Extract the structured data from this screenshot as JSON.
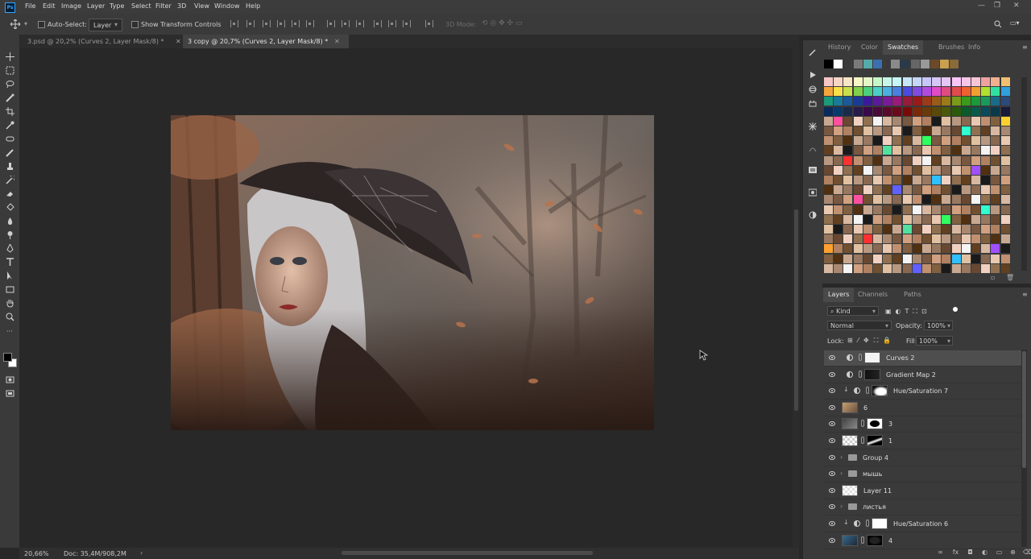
{
  "app": {
    "logo": "Ps"
  },
  "menu": [
    "File",
    "Edit",
    "Image",
    "Layer",
    "Type",
    "Select",
    "Filter",
    "3D",
    "View",
    "Window",
    "Help"
  ],
  "window_controls": [
    "—",
    "❐",
    "✕"
  ],
  "options_bar": {
    "auto_select_label": "Auto-Select:",
    "auto_select_target": "Layer",
    "show_transform_label": "Show Transform Controls",
    "mode_3d_label": "3D Mode:"
  },
  "tabs": [
    {
      "label": "3.psd @ 20,2% (Curves 2, Layer Mask/8) *",
      "active": false
    },
    {
      "label": "3 copy @ 20,7% (Curves 2, Layer Mask/8) *",
      "active": true
    }
  ],
  "status": {
    "zoom": "20,66%",
    "doc": "Doc: 35,4M/908,2M",
    "arrow": "›"
  },
  "panel_tabs_top": [
    "History",
    "Color",
    "Swatches",
    "Brushes",
    "Info"
  ],
  "active_top_tab": "Swatches",
  "panel_tabs_layers": [
    "Layers",
    "Channels",
    "Paths"
  ],
  "active_layers_tab": "Layers",
  "layers_controls": {
    "kind": "Kind",
    "blend_mode": "Normal",
    "opacity_label": "Opacity:",
    "opacity_value": "100%",
    "lock_label": "Lock:",
    "fill_label": "Fill:",
    "fill_value": "100%"
  },
  "layers": [
    {
      "name": "Curves 2",
      "type": "adjustment",
      "selected": true,
      "clipped": false
    },
    {
      "name": "Gradient Map 2",
      "type": "adjustment",
      "selected": false,
      "clipped": false
    },
    {
      "name": "Hue/Saturation 7",
      "type": "adjustment",
      "selected": false,
      "clipped": true
    },
    {
      "name": "6",
      "type": "smart",
      "selected": false,
      "clipped": false
    },
    {
      "name": "3",
      "type": "smart-mask",
      "selected": false,
      "clipped": false
    },
    {
      "name": "1",
      "type": "smart-mask",
      "selected": false,
      "clipped": false
    },
    {
      "name": "Group 4",
      "type": "group",
      "selected": false,
      "clipped": false
    },
    {
      "name": "мышь",
      "type": "group",
      "selected": false,
      "clipped": false
    },
    {
      "name": "Layer 11",
      "type": "pixel",
      "selected": false,
      "clipped": false
    },
    {
      "name": "листья",
      "type": "group",
      "selected": false,
      "clipped": false
    },
    {
      "name": "Hue/Saturation 6",
      "type": "adjustment",
      "selected": false,
      "clipped": true
    },
    {
      "name": "4",
      "type": "smart-mask",
      "selected": false,
      "clipped": false
    }
  ],
  "colors": {
    "accent": "#31a8ff",
    "panel_bg": "#3a3a3a",
    "canvas_bg": "#282828"
  }
}
